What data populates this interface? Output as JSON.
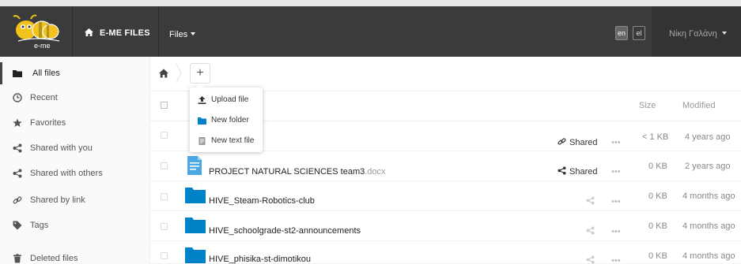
{
  "header": {
    "logo_text": "e-me",
    "brand": "E-ME FILES",
    "files_menu": "Files",
    "languages": [
      {
        "code": "en",
        "active": true
      },
      {
        "code": "el",
        "active": false
      }
    ],
    "user_name": "Νίκη Γαλάνη"
  },
  "sidebar": {
    "items": [
      {
        "label": "All files",
        "icon": "folder-icon"
      },
      {
        "label": "Recent",
        "icon": "clock-icon"
      },
      {
        "label": "Favorites",
        "icon": "star-icon"
      },
      {
        "label": "Shared with you",
        "icon": "share-icon"
      },
      {
        "label": "Shared with others",
        "icon": "share-icon"
      },
      {
        "label": "Shared by link",
        "icon": "link-icon"
      },
      {
        "label": "Tags",
        "icon": "tag-icon"
      },
      {
        "label": "Deleted files",
        "icon": "trash-icon"
      }
    ]
  },
  "toolbar": {
    "add_label": "+"
  },
  "new_menu": {
    "items": [
      {
        "label": "Upload file",
        "icon": "upload-icon"
      },
      {
        "label": "New folder",
        "icon": "folder-icon"
      },
      {
        "label": "New text file",
        "icon": "text-file-icon"
      }
    ]
  },
  "table": {
    "columns": {
      "size": "Size",
      "modified": "Modified"
    },
    "rows": [
      {
        "name": "",
        "ext": "",
        "shared_label": "Shared",
        "size": "< 1 KB",
        "modified": "4 years ago"
      },
      {
        "name": "PROJECT NATURAL SCIENCES team3",
        "ext": ".docx",
        "shared_label": "Shared",
        "size": "0 KB",
        "modified": "2 years ago"
      },
      {
        "name": "HIVE_Steam-Robotics-club",
        "ext": "",
        "shared_label": "",
        "size": "0 KB",
        "modified": "4 months ago"
      },
      {
        "name": "HIVE_schoolgrade-st2-announcements",
        "ext": "",
        "shared_label": "",
        "size": "0 KB",
        "modified": "4 months ago"
      },
      {
        "name": "HIVE_phisika-st-dimotikou",
        "ext": "",
        "shared_label": "",
        "size": "0 KB",
        "modified": "4 months ago"
      }
    ],
    "more_label": "•••"
  },
  "colors": {
    "header_bg": "#3b3b3b",
    "folder_blue": "#0082c9",
    "doc_blue": "#4aa8e4"
  }
}
